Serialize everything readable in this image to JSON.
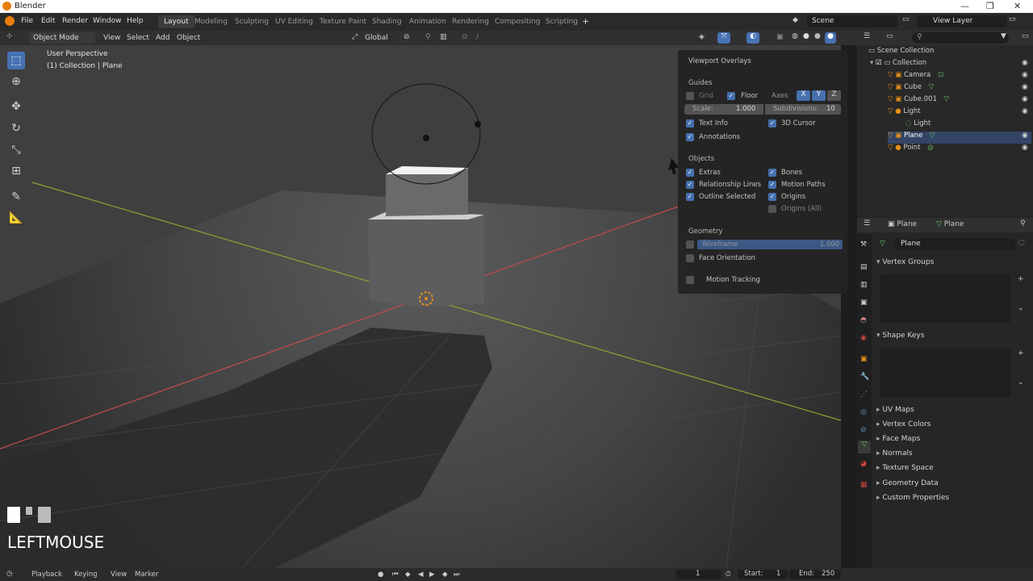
{
  "window": {
    "title": "Blender"
  },
  "menu": [
    "File",
    "Edit",
    "Render",
    "Window",
    "Help"
  ],
  "workspaces": [
    "Layout",
    "Modeling",
    "Sculpting",
    "UV Editing",
    "Texture Paint",
    "Shading",
    "Animation",
    "Rendering",
    "Compositing",
    "Scripting"
  ],
  "add_tab": "+",
  "scene": {
    "label": "Scene",
    "view_layer": "View Layer"
  },
  "header": {
    "mode": "Object Mode",
    "view": "View",
    "select": "Select",
    "add": "Add",
    "object": "Object",
    "orientation": "Global"
  },
  "viewport": {
    "info_line1": "User Perspective",
    "info_line2": "(1) Collection | Plane",
    "key_hint": "LEFTMOUSE"
  },
  "overlays": {
    "title": "Viewport Overlays",
    "guides": "Guides",
    "grid": "Grid",
    "floor": "Floor",
    "axes": "Axes",
    "x": "X",
    "y": "Y",
    "z": "Z",
    "scale_label": "Scale:",
    "scale_value": "1.000",
    "subdiv_label": "Subdivisions:",
    "subdiv_value": "10",
    "text_info": "Text Info",
    "cursor_3d": "3D Cursor",
    "annotations": "Annotations",
    "objects": "Objects",
    "extras": "Extras",
    "bones": "Bones",
    "rel_lines": "Relationship Lines",
    "motion_paths": "Motion Paths",
    "outline_selected": "Outline Selected",
    "origins": "Origins",
    "origins_all": "Origins (All)",
    "geometry": "Geometry",
    "wireframe": "Wireframe",
    "wireframe_value": "1.000",
    "face_orientation": "Face Orientation",
    "motion_tracking": "Motion Tracking"
  },
  "outliner": {
    "scene_collection": "Scene Collection",
    "items": [
      {
        "label": "Collection"
      },
      {
        "label": "Camera"
      },
      {
        "label": "Cube"
      },
      {
        "label": "Cube.001"
      },
      {
        "label": "Light"
      },
      {
        "label": "Light"
      },
      {
        "label": "Plane"
      },
      {
        "label": "Point"
      }
    ]
  },
  "properties": {
    "obj": "Plane",
    "data": "Plane",
    "mesh_name": "Plane",
    "vertex_groups": "Vertex Groups",
    "shape_keys": "Shape Keys",
    "sections": [
      "UV Maps",
      "Vertex Colors",
      "Face Maps",
      "Normals",
      "Texture Space",
      "Geometry Data",
      "Custom Properties"
    ]
  },
  "timeline": {
    "playback": "Playback",
    "keying": "Keying",
    "view": "View",
    "marker": "Marker",
    "frame": "1",
    "start_label": "Start:",
    "start": "1",
    "end_label": "End:",
    "end": "250"
  },
  "colors": {
    "accent": "#4772b3",
    "viewport_bg": "#3f3f3f",
    "x_axis": "#c44a4a",
    "y_axis": "#8fa035",
    "light_orange": "#e8901a"
  }
}
